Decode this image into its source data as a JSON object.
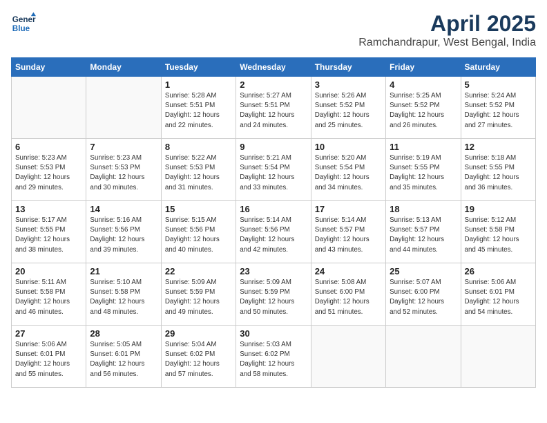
{
  "logo": {
    "line1": "General",
    "line2": "Blue"
  },
  "title": "April 2025",
  "subtitle": "Ramchandrapur, West Bengal, India",
  "header": {
    "days": [
      "Sunday",
      "Monday",
      "Tuesday",
      "Wednesday",
      "Thursday",
      "Friday",
      "Saturday"
    ]
  },
  "weeks": [
    [
      {
        "day": "",
        "sunrise": "",
        "sunset": "",
        "daylight": ""
      },
      {
        "day": "",
        "sunrise": "",
        "sunset": "",
        "daylight": ""
      },
      {
        "day": "1",
        "sunrise": "Sunrise: 5:28 AM",
        "sunset": "Sunset: 5:51 PM",
        "daylight": "Daylight: 12 hours and 22 minutes."
      },
      {
        "day": "2",
        "sunrise": "Sunrise: 5:27 AM",
        "sunset": "Sunset: 5:51 PM",
        "daylight": "Daylight: 12 hours and 24 minutes."
      },
      {
        "day": "3",
        "sunrise": "Sunrise: 5:26 AM",
        "sunset": "Sunset: 5:52 PM",
        "daylight": "Daylight: 12 hours and 25 minutes."
      },
      {
        "day": "4",
        "sunrise": "Sunrise: 5:25 AM",
        "sunset": "Sunset: 5:52 PM",
        "daylight": "Daylight: 12 hours and 26 minutes."
      },
      {
        "day": "5",
        "sunrise": "Sunrise: 5:24 AM",
        "sunset": "Sunset: 5:52 PM",
        "daylight": "Daylight: 12 hours and 27 minutes."
      }
    ],
    [
      {
        "day": "6",
        "sunrise": "Sunrise: 5:23 AM",
        "sunset": "Sunset: 5:53 PM",
        "daylight": "Daylight: 12 hours and 29 minutes."
      },
      {
        "day": "7",
        "sunrise": "Sunrise: 5:23 AM",
        "sunset": "Sunset: 5:53 PM",
        "daylight": "Daylight: 12 hours and 30 minutes."
      },
      {
        "day": "8",
        "sunrise": "Sunrise: 5:22 AM",
        "sunset": "Sunset: 5:53 PM",
        "daylight": "Daylight: 12 hours and 31 minutes."
      },
      {
        "day": "9",
        "sunrise": "Sunrise: 5:21 AM",
        "sunset": "Sunset: 5:54 PM",
        "daylight": "Daylight: 12 hours and 33 minutes."
      },
      {
        "day": "10",
        "sunrise": "Sunrise: 5:20 AM",
        "sunset": "Sunset: 5:54 PM",
        "daylight": "Daylight: 12 hours and 34 minutes."
      },
      {
        "day": "11",
        "sunrise": "Sunrise: 5:19 AM",
        "sunset": "Sunset: 5:55 PM",
        "daylight": "Daylight: 12 hours and 35 minutes."
      },
      {
        "day": "12",
        "sunrise": "Sunrise: 5:18 AM",
        "sunset": "Sunset: 5:55 PM",
        "daylight": "Daylight: 12 hours and 36 minutes."
      }
    ],
    [
      {
        "day": "13",
        "sunrise": "Sunrise: 5:17 AM",
        "sunset": "Sunset: 5:55 PM",
        "daylight": "Daylight: 12 hours and 38 minutes."
      },
      {
        "day": "14",
        "sunrise": "Sunrise: 5:16 AM",
        "sunset": "Sunset: 5:56 PM",
        "daylight": "Daylight: 12 hours and 39 minutes."
      },
      {
        "day": "15",
        "sunrise": "Sunrise: 5:15 AM",
        "sunset": "Sunset: 5:56 PM",
        "daylight": "Daylight: 12 hours and 40 minutes."
      },
      {
        "day": "16",
        "sunrise": "Sunrise: 5:14 AM",
        "sunset": "Sunset: 5:56 PM",
        "daylight": "Daylight: 12 hours and 42 minutes."
      },
      {
        "day": "17",
        "sunrise": "Sunrise: 5:14 AM",
        "sunset": "Sunset: 5:57 PM",
        "daylight": "Daylight: 12 hours and 43 minutes."
      },
      {
        "day": "18",
        "sunrise": "Sunrise: 5:13 AM",
        "sunset": "Sunset: 5:57 PM",
        "daylight": "Daylight: 12 hours and 44 minutes."
      },
      {
        "day": "19",
        "sunrise": "Sunrise: 5:12 AM",
        "sunset": "Sunset: 5:58 PM",
        "daylight": "Daylight: 12 hours and 45 minutes."
      }
    ],
    [
      {
        "day": "20",
        "sunrise": "Sunrise: 5:11 AM",
        "sunset": "Sunset: 5:58 PM",
        "daylight": "Daylight: 12 hours and 46 minutes."
      },
      {
        "day": "21",
        "sunrise": "Sunrise: 5:10 AM",
        "sunset": "Sunset: 5:58 PM",
        "daylight": "Daylight: 12 hours and 48 minutes."
      },
      {
        "day": "22",
        "sunrise": "Sunrise: 5:09 AM",
        "sunset": "Sunset: 5:59 PM",
        "daylight": "Daylight: 12 hours and 49 minutes."
      },
      {
        "day": "23",
        "sunrise": "Sunrise: 5:09 AM",
        "sunset": "Sunset: 5:59 PM",
        "daylight": "Daylight: 12 hours and 50 minutes."
      },
      {
        "day": "24",
        "sunrise": "Sunrise: 5:08 AM",
        "sunset": "Sunset: 6:00 PM",
        "daylight": "Daylight: 12 hours and 51 minutes."
      },
      {
        "day": "25",
        "sunrise": "Sunrise: 5:07 AM",
        "sunset": "Sunset: 6:00 PM",
        "daylight": "Daylight: 12 hours and 52 minutes."
      },
      {
        "day": "26",
        "sunrise": "Sunrise: 5:06 AM",
        "sunset": "Sunset: 6:01 PM",
        "daylight": "Daylight: 12 hours and 54 minutes."
      }
    ],
    [
      {
        "day": "27",
        "sunrise": "Sunrise: 5:06 AM",
        "sunset": "Sunset: 6:01 PM",
        "daylight": "Daylight: 12 hours and 55 minutes."
      },
      {
        "day": "28",
        "sunrise": "Sunrise: 5:05 AM",
        "sunset": "Sunset: 6:01 PM",
        "daylight": "Daylight: 12 hours and 56 minutes."
      },
      {
        "day": "29",
        "sunrise": "Sunrise: 5:04 AM",
        "sunset": "Sunset: 6:02 PM",
        "daylight": "Daylight: 12 hours and 57 minutes."
      },
      {
        "day": "30",
        "sunrise": "Sunrise: 5:03 AM",
        "sunset": "Sunset: 6:02 PM",
        "daylight": "Daylight: 12 hours and 58 minutes."
      },
      {
        "day": "",
        "sunrise": "",
        "sunset": "",
        "daylight": ""
      },
      {
        "day": "",
        "sunrise": "",
        "sunset": "",
        "daylight": ""
      },
      {
        "day": "",
        "sunrise": "",
        "sunset": "",
        "daylight": ""
      }
    ]
  ]
}
